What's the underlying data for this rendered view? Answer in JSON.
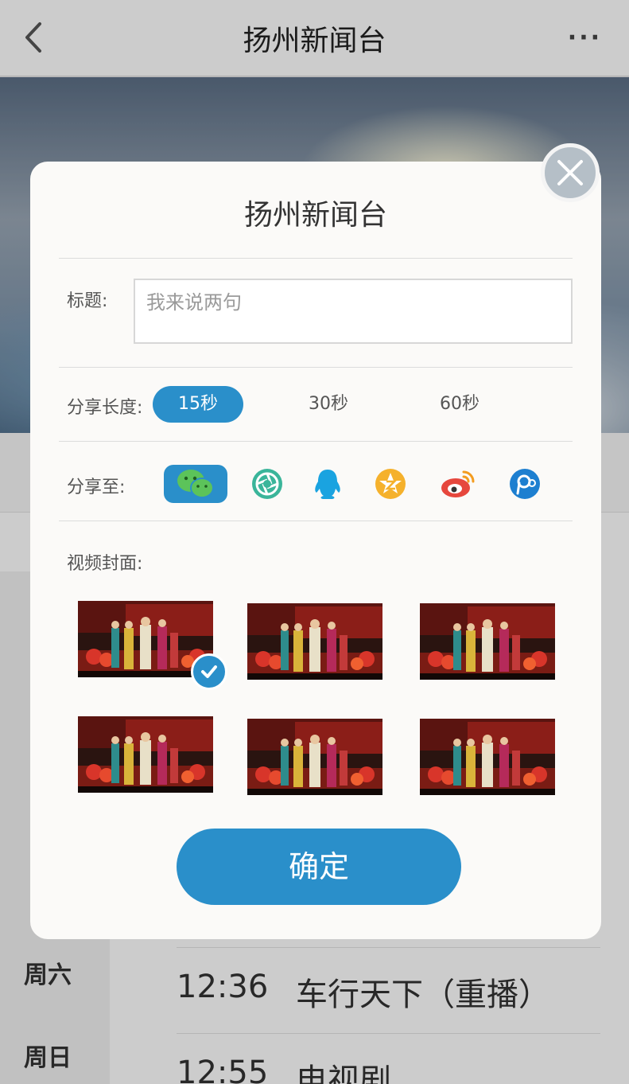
{
  "app": {
    "title": "扬州新闻台",
    "more_label": "···"
  },
  "schedule": {
    "days": [
      {
        "label": "周六"
      },
      {
        "label": "周日"
      }
    ],
    "rows": [
      {
        "time": "12:36",
        "name": "车行天下（重播）"
      },
      {
        "time": "12:55",
        "name": "电视剧"
      }
    ]
  },
  "dialog": {
    "title": "扬州新闻台",
    "title_label": "标题:",
    "title_placeholder": "我来说两句",
    "duration_label": "分享长度:",
    "durations": [
      {
        "label": "15秒",
        "active": true
      },
      {
        "label": "30秒",
        "active": false
      },
      {
        "label": "60秒",
        "active": false
      }
    ],
    "share_label": "分享至:",
    "share_targets": [
      {
        "icon": "wechat-icon",
        "active": true
      },
      {
        "icon": "moments-icon",
        "active": false
      },
      {
        "icon": "qq-icon",
        "active": false
      },
      {
        "icon": "qzone-icon",
        "active": false
      },
      {
        "icon": "weibo-icon",
        "active": false
      },
      {
        "icon": "tencent-weibo-icon",
        "active": false
      }
    ],
    "cover_label": "视频封面:",
    "covers": [
      {
        "selected": true
      },
      {
        "selected": false
      },
      {
        "selected": false
      },
      {
        "selected": false
      },
      {
        "selected": false
      },
      {
        "selected": false
      }
    ],
    "confirm_label": "确定"
  },
  "colors": {
    "accent": "#2a8fca",
    "close_button": "#b5bfc7",
    "dialog_bg": "#fbfaf8"
  }
}
